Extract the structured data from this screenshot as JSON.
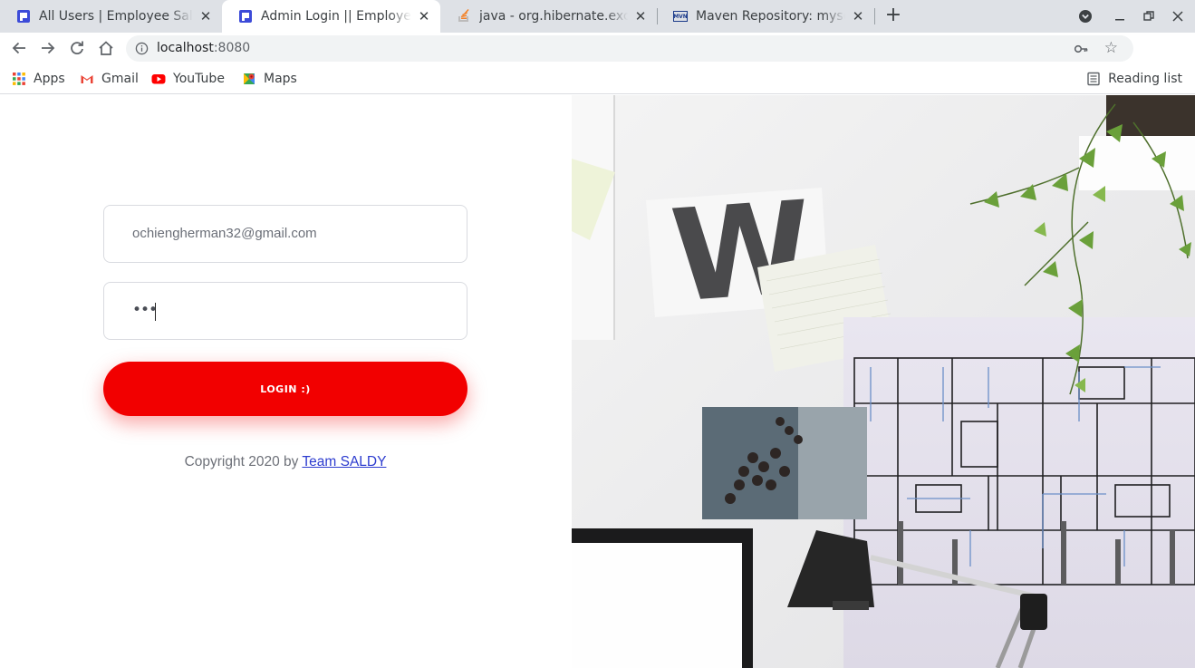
{
  "browser": {
    "tabs": [
      {
        "title": "All Users | Employee Salary",
        "icon": "app-favicon",
        "active": false
      },
      {
        "title": "Admin Login || Employee Salary",
        "icon": "app-favicon",
        "active": true
      },
      {
        "title": "java - org.hibernate.exception",
        "icon": "stackoverflow-favicon",
        "active": false
      },
      {
        "title": "Maven Repository: mysql",
        "icon": "mvn-favicon",
        "active": false
      }
    ],
    "mvn_badge": "MVN",
    "url_host": "localhost",
    "url_port": ":8080",
    "bookmarks": [
      {
        "label": "Apps",
        "icon": "apps-grid-icon"
      },
      {
        "label": "Gmail",
        "icon": "gmail-icon"
      },
      {
        "label": "YouTube",
        "icon": "youtube-icon"
      },
      {
        "label": "Maps",
        "icon": "maps-icon"
      }
    ],
    "reading_list": "Reading list"
  },
  "login": {
    "email_value": "ochiengherman32@gmail.com",
    "password_mask": "•••",
    "button_label": "LOGIN :)",
    "copyright_prefix": "Copyright 2020 by ",
    "copyright_link": "Team SALDY"
  },
  "hero": {
    "letter": "W"
  },
  "colors": {
    "accent": "#f20000",
    "link": "#2d3ccf",
    "tabstrip": "#dee1e6"
  }
}
